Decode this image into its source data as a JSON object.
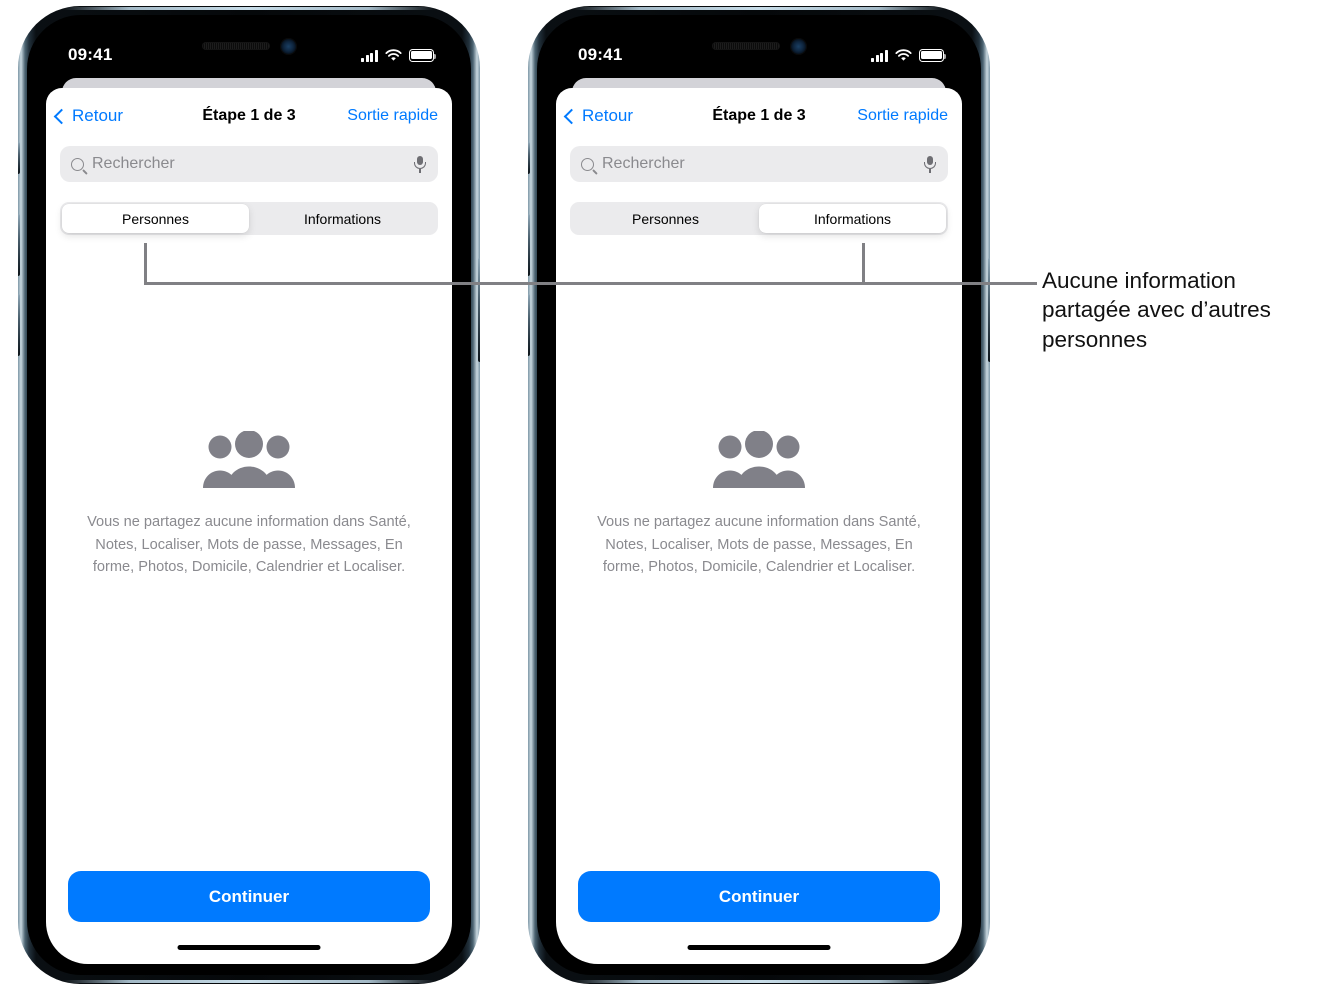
{
  "phones": [
    {
      "id": "phone-left",
      "status_bar": {
        "time": "09:41",
        "cellular": "signal-bars-icon",
        "wifi": "wifi-icon",
        "battery": "battery-icon"
      },
      "nav": {
        "back_label": "Retour",
        "title": "Étape 1 de 3",
        "action_label": "Sortie rapide"
      },
      "search": {
        "placeholder": "Rechercher",
        "search_icon": "search-icon",
        "mic_icon": "microphone-icon"
      },
      "segmented": {
        "options": [
          "Personnes",
          "Informations"
        ],
        "selected": "Personnes",
        "selected_index": 0
      },
      "empty_state": {
        "icon": "people-group-icon",
        "message": "Vous ne partagez aucune information dans Santé, Notes, Localiser, Mots de passe, Messages, En forme, Photos, Domicile, Calendrier et Localiser."
      },
      "cta_label": "Continuer"
    },
    {
      "id": "phone-right",
      "status_bar": {
        "time": "09:41",
        "cellular": "signal-bars-icon",
        "wifi": "wifi-icon",
        "battery": "battery-icon"
      },
      "nav": {
        "back_label": "Retour",
        "title": "Étape 1 de 3",
        "action_label": "Sortie rapide"
      },
      "search": {
        "placeholder": "Rechercher",
        "search_icon": "search-icon",
        "mic_icon": "microphone-icon"
      },
      "segmented": {
        "options": [
          "Personnes",
          "Informations"
        ],
        "selected": "Informations",
        "selected_index": 1
      },
      "empty_state": {
        "icon": "people-group-icon",
        "message": "Vous ne partagez aucune information dans Santé, Notes, Localiser, Mots de passe, Messages, En forme, Photos, Domicile, Calendrier et Localiser."
      },
      "cta_label": "Continuer"
    }
  ],
  "callout": {
    "text": "Aucune information partagée avec d’autres personnes",
    "line_color": "#808084"
  },
  "colors": {
    "accent_blue": "#007aff",
    "segment_track": "#ebebed",
    "muted_text": "#8a8a8f",
    "icon_gray": "#808088",
    "callout_gray": "#808084"
  }
}
